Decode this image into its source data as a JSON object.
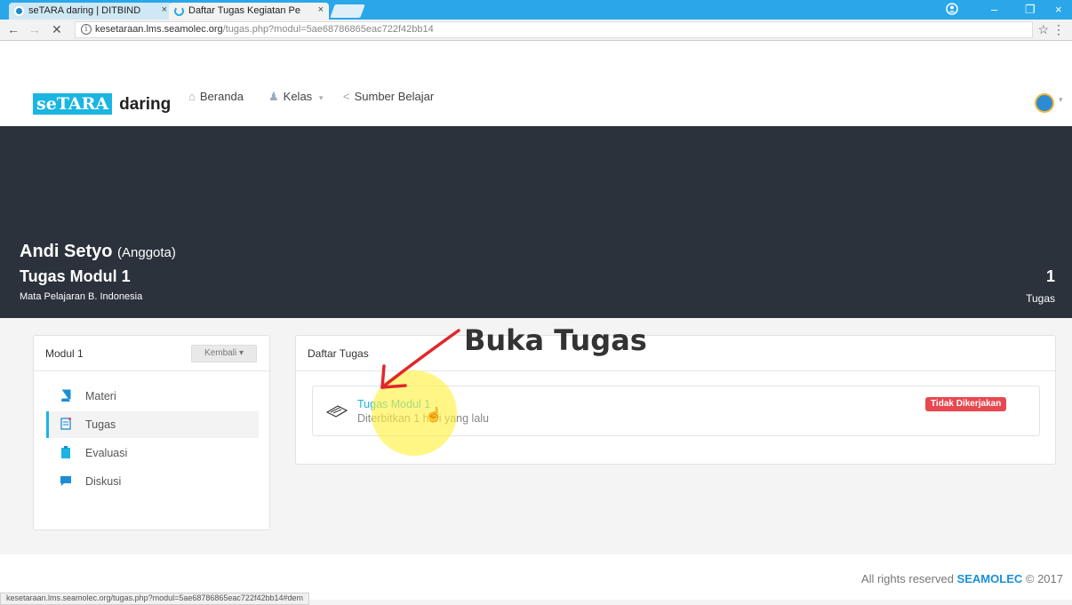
{
  "browser": {
    "tabs": [
      {
        "title": "seTARA daring | DITBIND",
        "close": "×"
      },
      {
        "title": "Daftar Tugas Kegiatan Pe",
        "close": "×"
      }
    ],
    "window_controls": {
      "minimize": "–",
      "maximize": "❐",
      "close": "×"
    },
    "nav": {
      "back": "←",
      "forward": "→",
      "stop": "✕"
    },
    "url": {
      "host": "kesetaraan.lms.seamolec.org",
      "path": "/tugas.php?modul=5ae68786865eac722f42bb14"
    },
    "info_icon": "i",
    "star": "☆",
    "menu": "⋮",
    "status_url": "kesetaraan.lms.seamolec.org/tugas.php?modul=5ae68786865eac722f42bb14#dem"
  },
  "site": {
    "logo": {
      "part1": "seTARA",
      "part2": "daring"
    },
    "nav": [
      {
        "label": "Beranda",
        "icon": "home-icon",
        "glyph": "⌂"
      },
      {
        "label": "Kelas",
        "icon": "users-icon",
        "glyph": "♟",
        "caret": "▾"
      },
      {
        "label": "Sumber Belajar",
        "icon": "share-icon",
        "glyph": "<"
      }
    ],
    "avatar_caret": "▾"
  },
  "hero": {
    "name": "Andi Setyo",
    "role": "(Anggota)",
    "title": "Tugas Modul 1",
    "subtitle": "Mata Pelajaran B. Indonesia",
    "count": "1",
    "count_label": "Tugas"
  },
  "sidebar": {
    "title": "Modul 1",
    "back_button": "Kembali ▾",
    "items": [
      {
        "label": "Materi",
        "icon": "book-icon",
        "active": false
      },
      {
        "label": "Tugas",
        "icon": "task-icon",
        "active": true
      },
      {
        "label": "Evaluasi",
        "icon": "clipboard-icon",
        "active": false
      },
      {
        "label": "Diskusi",
        "icon": "chat-icon",
        "active": false
      }
    ]
  },
  "tasks_panel": {
    "title": "Daftar Tugas",
    "task": {
      "name": "Tugas Modul 1",
      "meta": "Diterbitkan 1 hari yang lalu",
      "status": "Tidak Dikerjakan"
    }
  },
  "annotation": "Buka Tugas",
  "footer": {
    "text": "All rights reserved",
    "brand": "SEAMOLEC",
    "copy": "© 2017"
  },
  "colors": {
    "accent": "#1ab5e0",
    "hero": "#2b323c",
    "badge": "#e8484f",
    "tabstrip": "#2aa7e9",
    "annotation_arrow": "#e2262b"
  }
}
